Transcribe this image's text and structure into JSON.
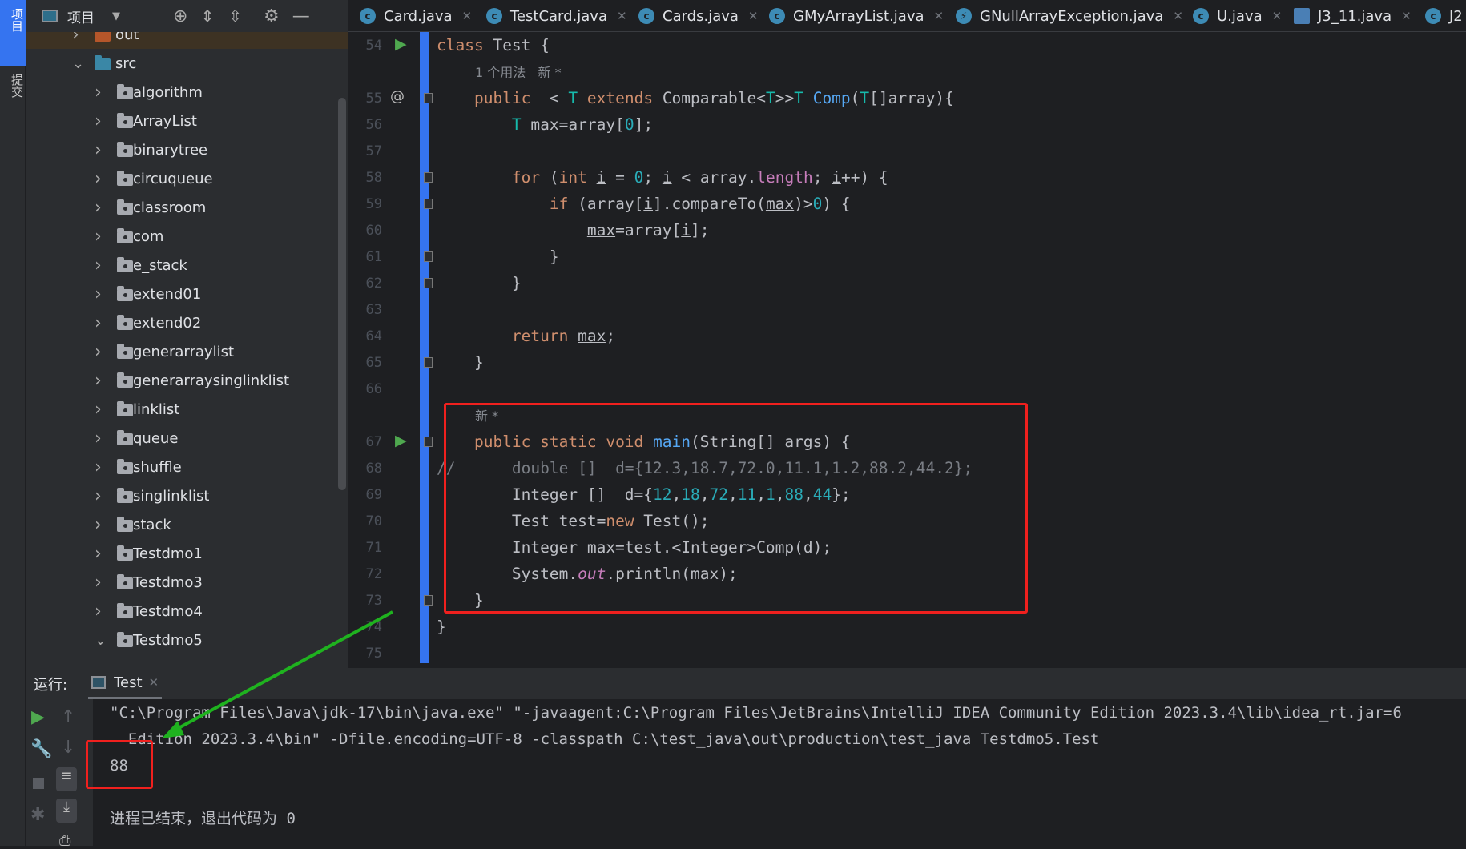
{
  "sidebar_strip": {
    "project": "项目",
    "commit": "提交"
  },
  "project_toolbar": {
    "title": "项目"
  },
  "tree": [
    {
      "label": "out",
      "level": 0,
      "expanded": false,
      "type": "excluded"
    },
    {
      "label": "src",
      "level": 0,
      "expanded": true,
      "type": "source"
    },
    {
      "label": "algorithm",
      "level": 1,
      "expanded": false,
      "type": "package"
    },
    {
      "label": "ArrayList",
      "level": 1,
      "expanded": false,
      "type": "package"
    },
    {
      "label": "binarytree",
      "level": 1,
      "expanded": false,
      "type": "package"
    },
    {
      "label": "circuqueue",
      "level": 1,
      "expanded": false,
      "type": "package"
    },
    {
      "label": "classroom",
      "level": 1,
      "expanded": false,
      "type": "package"
    },
    {
      "label": "com",
      "level": 1,
      "expanded": false,
      "type": "package"
    },
    {
      "label": "e_stack",
      "level": 1,
      "expanded": false,
      "type": "package"
    },
    {
      "label": "extend01",
      "level": 1,
      "expanded": false,
      "type": "package"
    },
    {
      "label": "extend02",
      "level": 1,
      "expanded": false,
      "type": "package"
    },
    {
      "label": "generarraylist",
      "level": 1,
      "expanded": false,
      "type": "package"
    },
    {
      "label": "generarraysinglinklist",
      "level": 1,
      "expanded": false,
      "type": "package"
    },
    {
      "label": "linklist",
      "level": 1,
      "expanded": false,
      "type": "package"
    },
    {
      "label": "queue",
      "level": 1,
      "expanded": false,
      "type": "package"
    },
    {
      "label": "shuffle",
      "level": 1,
      "expanded": false,
      "type": "package"
    },
    {
      "label": "singlinklist",
      "level": 1,
      "expanded": false,
      "type": "package"
    },
    {
      "label": "stack",
      "level": 1,
      "expanded": false,
      "type": "package"
    },
    {
      "label": "Testdmo1",
      "level": 1,
      "expanded": false,
      "type": "package"
    },
    {
      "label": "Testdmo3",
      "level": 1,
      "expanded": false,
      "type": "package"
    },
    {
      "label": "Testdmo4",
      "level": 1,
      "expanded": false,
      "type": "package"
    },
    {
      "label": "Testdmo5",
      "level": 1,
      "expanded": true,
      "type": "package"
    }
  ],
  "tabs": [
    {
      "label": "Card.java",
      "icon": "class-icon"
    },
    {
      "label": "TestCard.java",
      "icon": "class-icon"
    },
    {
      "label": "Cards.java",
      "icon": "class-icon"
    },
    {
      "label": "GMyArrayList.java",
      "icon": "class-icon"
    },
    {
      "label": "GNullArrayException.java",
      "icon": "exception-icon"
    },
    {
      "label": "U.java",
      "icon": "class-icon"
    },
    {
      "label": "J3_11.java",
      "icon": "java-file-icon"
    },
    {
      "label": "J2",
      "icon": "class-icon"
    }
  ],
  "colors": {
    "keyword": "#cf8e6d",
    "type": "#16baac",
    "method": "#56a8f5",
    "number": "#2aacb8",
    "text": "#bcbec4",
    "comment": "#7a7e85",
    "field": "#c77dbb",
    "hint": "#868a91",
    "highlight_box": "#f0201e",
    "arrow": "#1fb21f"
  },
  "code": [
    {
      "n": "54",
      "run": true,
      "tokens": [
        [
          "class ",
          "k"
        ],
        [
          "Test {",
          "t"
        ]
      ]
    },
    {
      "n": "",
      "hint": "1 个用法   新 *",
      "indent": 4
    },
    {
      "n": "55",
      "at": true,
      "fold": true,
      "tokens": [
        [
          "    "
        ],
        [
          "public",
          "k"
        ],
        [
          "  < "
        ],
        [
          "T",
          "ty"
        ],
        [
          " "
        ],
        [
          "extends",
          "k"
        ],
        [
          " Comparable<"
        ],
        [
          "T",
          "ty"
        ],
        [
          ">>"
        ],
        [
          "T",
          "ty"
        ],
        [
          " "
        ],
        [
          "Comp",
          "m"
        ],
        [
          "("
        ],
        [
          "T",
          "ty"
        ],
        [
          "[]array){"
        ]
      ]
    },
    {
      "n": "56",
      "tokens": [
        [
          "        "
        ],
        [
          "T",
          "ty"
        ],
        [
          " "
        ],
        [
          "max",
          "u"
        ],
        [
          "=array["
        ],
        [
          "0",
          "num"
        ],
        [
          "];"
        ]
      ]
    },
    {
      "n": "57",
      "tokens": []
    },
    {
      "n": "58",
      "fold": true,
      "tokens": [
        [
          "        "
        ],
        [
          "for",
          "k"
        ],
        [
          " ("
        ],
        [
          "int",
          "k"
        ],
        [
          " "
        ],
        [
          "i",
          "u"
        ],
        [
          " = "
        ],
        [
          "0",
          "num"
        ],
        [
          "; "
        ],
        [
          "i",
          "u"
        ],
        [
          " < array."
        ],
        [
          "length",
          "f"
        ],
        [
          "; "
        ],
        [
          "i",
          "u"
        ],
        [
          "++) {"
        ]
      ]
    },
    {
      "n": "59",
      "fold": true,
      "tokens": [
        [
          "            "
        ],
        [
          "if",
          "k"
        ],
        [
          " (array["
        ],
        [
          "i",
          "u"
        ],
        [
          "].compareTo("
        ],
        [
          "max",
          "u"
        ],
        [
          ")>"
        ],
        [
          "0",
          "num"
        ],
        [
          ") {"
        ]
      ]
    },
    {
      "n": "60",
      "tokens": [
        [
          "                "
        ],
        [
          "max",
          "u"
        ],
        [
          "=array["
        ],
        [
          "i",
          "u"
        ],
        [
          "];"
        ]
      ]
    },
    {
      "n": "61",
      "fold": true,
      "tokens": [
        [
          "            }"
        ]
      ]
    },
    {
      "n": "62",
      "fold": true,
      "tokens": [
        [
          "        }"
        ]
      ]
    },
    {
      "n": "63",
      "tokens": []
    },
    {
      "n": "64",
      "tokens": [
        [
          "        "
        ],
        [
          "return",
          "k"
        ],
        [
          " "
        ],
        [
          "max",
          "u"
        ],
        [
          ";"
        ]
      ]
    },
    {
      "n": "65",
      "fold": true,
      "tokens": [
        [
          "    }"
        ]
      ]
    },
    {
      "n": "66",
      "tokens": []
    },
    {
      "n": "",
      "hint": "新 *",
      "indent": 4
    },
    {
      "n": "67",
      "run": true,
      "fold": true,
      "tokens": [
        [
          "    "
        ],
        [
          "public static void",
          "k"
        ],
        [
          " "
        ],
        [
          "main",
          "m"
        ],
        [
          "(String[] args) {"
        ]
      ]
    },
    {
      "n": "68",
      "tokens": [
        [
          "//",
          "c"
        ],
        [
          "      double []  d={12.3,18.7,72.0,11.1,1.2,88.2,44.2};",
          "c"
        ]
      ]
    },
    {
      "n": "69",
      "tokens": [
        [
          "        Integer []  d={"
        ],
        [
          "12",
          "num"
        ],
        [
          ","
        ],
        [
          "18",
          "num"
        ],
        [
          ","
        ],
        [
          "72",
          "num"
        ],
        [
          ","
        ],
        [
          "11",
          "num"
        ],
        [
          ","
        ],
        [
          "1",
          "num"
        ],
        [
          ","
        ],
        [
          "88",
          "num"
        ],
        [
          ","
        ],
        [
          "44",
          "num"
        ],
        [
          "};"
        ]
      ]
    },
    {
      "n": "70",
      "tokens": [
        [
          "        Test test="
        ],
        [
          "new",
          "k"
        ],
        [
          " Test();"
        ]
      ]
    },
    {
      "n": "71",
      "tokens": [
        [
          "        Integer max=test.<Integer>Comp(d);"
        ]
      ]
    },
    {
      "n": "72",
      "tokens": [
        [
          "        System."
        ],
        [
          "out",
          "fi"
        ],
        [
          ".println(max);"
        ]
      ]
    },
    {
      "n": "73",
      "fold": true,
      "tokens": [
        [
          "    }"
        ]
      ]
    },
    {
      "n": "74",
      "tokens": [
        [
          "}"
        ]
      ]
    },
    {
      "n": "75",
      "tokens": []
    }
  ],
  "run_panel": {
    "label": "运行:",
    "tab": "Test"
  },
  "console": [
    "\"C:\\Program Files\\Java\\jdk-17\\bin\\java.exe\" \"-javaagent:C:\\Program Files\\JetBrains\\IntelliJ IDEA Community Edition 2023.3.4\\lib\\idea_rt.jar=6",
    "  Edition 2023.3.4\\bin\" -Dfile.encoding=UTF-8 -classpath C:\\test_java\\out\\production\\test_java Testdmo5.Test",
    "88",
    "",
    "进程已结束，退出代码为 0"
  ]
}
